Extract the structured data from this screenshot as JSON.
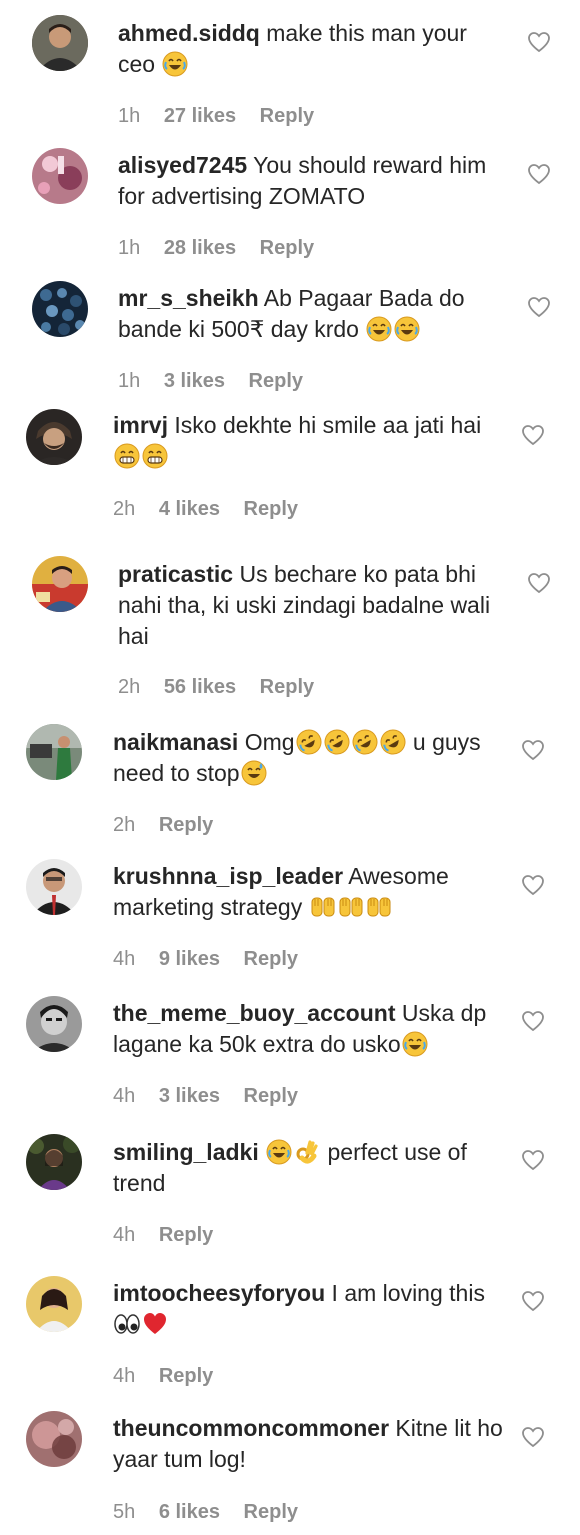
{
  "comments": [
    {
      "username": "ahmed.siddq",
      "text": "make this man your ceo",
      "emoji": [
        "laugh"
      ],
      "time": "1h",
      "likes": "27 likes",
      "reply": "Reply",
      "avatar_color": "#5a4a3e"
    },
    {
      "username": "alisyed7245",
      "text": "You should reward him for advertising ZOMATO",
      "emoji": [],
      "time": "1h",
      "likes": "28 likes",
      "reply": "Reply",
      "avatar_color": "#c88a9a"
    },
    {
      "username": "mr_s_sheikh",
      "text": "Ab Pagaar Bada do bande ki 500₹ day krdo",
      "emoji": [
        "laugh",
        "laugh"
      ],
      "time": "1h",
      "likes": "3 likes",
      "reply": "Reply",
      "avatar_color": "#1f3550"
    },
    {
      "username": "imrvj",
      "text": "Isko dekhte hi smile aa jati hai",
      "emoji": [
        "grin",
        "grin"
      ],
      "time": "2h",
      "likes": "4 likes",
      "reply": "Reply",
      "avatar_color": "#3a3230"
    },
    {
      "username": "praticastic",
      "text": "Us bechare ko pata bhi nahi tha, ki uski zindagi badalne wali hai",
      "emoji": [],
      "time": "2h",
      "likes": "56 likes",
      "reply": "Reply",
      "avatar_color": "#c94a3a"
    },
    {
      "username": "naikmanasi",
      "text": "Omg",
      "text2": "u guys need to stop",
      "emoji": [
        "rofl",
        "rofl",
        "rofl",
        "rofl"
      ],
      "emoji2": [
        "sweat"
      ],
      "time": "2h",
      "likes": "",
      "reply": "Reply",
      "avatar_color": "#4a6a4a"
    },
    {
      "username": "krushnna_isp_leader",
      "text": "Awesome marketing strategy",
      "emoji": [
        "raise",
        "raise",
        "raise"
      ],
      "time": "4h",
      "likes": "9 likes",
      "reply": "Reply",
      "avatar_color": "#2a2a2a"
    },
    {
      "username": "the_meme_buoy_account",
      "text": "Uska dp lagane ka 50k extra do usko",
      "emoji": [
        "laugh"
      ],
      "time": "4h",
      "likes": "3 likes",
      "reply": "Reply",
      "avatar_color": "#1e1e1e"
    },
    {
      "username": "smiling_ladki",
      "text": "perfect use of trend",
      "emoji": [
        "laugh",
        "ok"
      ],
      "time": "4h",
      "likes": "",
      "reply": "Reply",
      "avatar_color": "#3a4030"
    },
    {
      "username": "imtoocheesyforyou",
      "text": "I am loving this",
      "emoji": [
        "eyes",
        "heart"
      ],
      "time": "4h",
      "likes": "",
      "reply": "Reply",
      "avatar_color": "#d8c070"
    },
    {
      "username": "theuncommoncommoner",
      "text": "Kitne lit ho yaar tum log!",
      "emoji": [],
      "time": "5h",
      "likes": "6 likes",
      "reply": "Reply",
      "avatar_color": "#8a5a58"
    }
  ]
}
